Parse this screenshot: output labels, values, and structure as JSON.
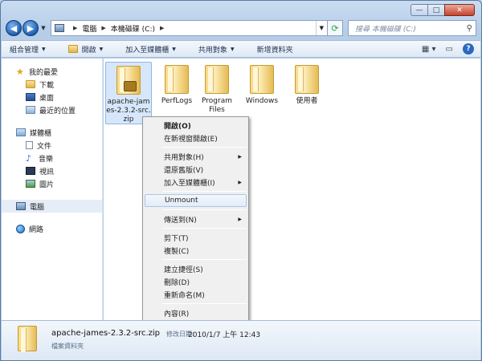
{
  "window": {
    "controls": {
      "minimize": "—",
      "maximize": "□",
      "close": "✕"
    }
  },
  "nav": {
    "back": "◀",
    "forward": "▶",
    "breadcrumb": [
      "電腦",
      "本機磁碟 (C:)"
    ],
    "search_placeholder": "搜尋 本機磁碟 (C:)"
  },
  "toolbar": {
    "items": [
      "組合管理",
      "開啟",
      "加入至媒體櫃",
      "共用對象",
      "新增資料夾"
    ]
  },
  "sidebar": {
    "favorites": {
      "label": "我的最愛",
      "items": [
        "下載",
        "桌面",
        "最近的位置"
      ]
    },
    "libraries": {
      "label": "媒體櫃",
      "items": [
        "文件",
        "音樂",
        "視訊",
        "圖片"
      ]
    },
    "computer": "電腦",
    "network": "網路"
  },
  "files": [
    {
      "name": "apache-james-2.3.2-src.zip",
      "type": "zip",
      "selected": true
    },
    {
      "name": "PerfLogs",
      "type": "folder"
    },
    {
      "name": "Program Files",
      "type": "folder"
    },
    {
      "name": "Windows",
      "type": "folder"
    },
    {
      "name": "使用者",
      "type": "folder"
    }
  ],
  "context_menu": {
    "groups": [
      [
        "開啟(O)",
        "在新視窗開啟(E)"
      ],
      [
        "共用對象(H)",
        "還原舊版(V)",
        "加入至媒體櫃(I)"
      ],
      [
        "Unmount"
      ],
      [
        "傳送到(N)"
      ],
      [
        "剪下(T)",
        "複製(C)"
      ],
      [
        "建立捷徑(S)",
        "刪除(D)",
        "重新命名(M)"
      ],
      [
        "內容(R)"
      ]
    ],
    "highlighted": "Unmount"
  },
  "details": {
    "name": "apache-james-2.3.2-src.zip",
    "modified_label": "修改日期:",
    "modified_value": "2010/1/7 上午 12:43",
    "type": "檔案資料夾"
  }
}
